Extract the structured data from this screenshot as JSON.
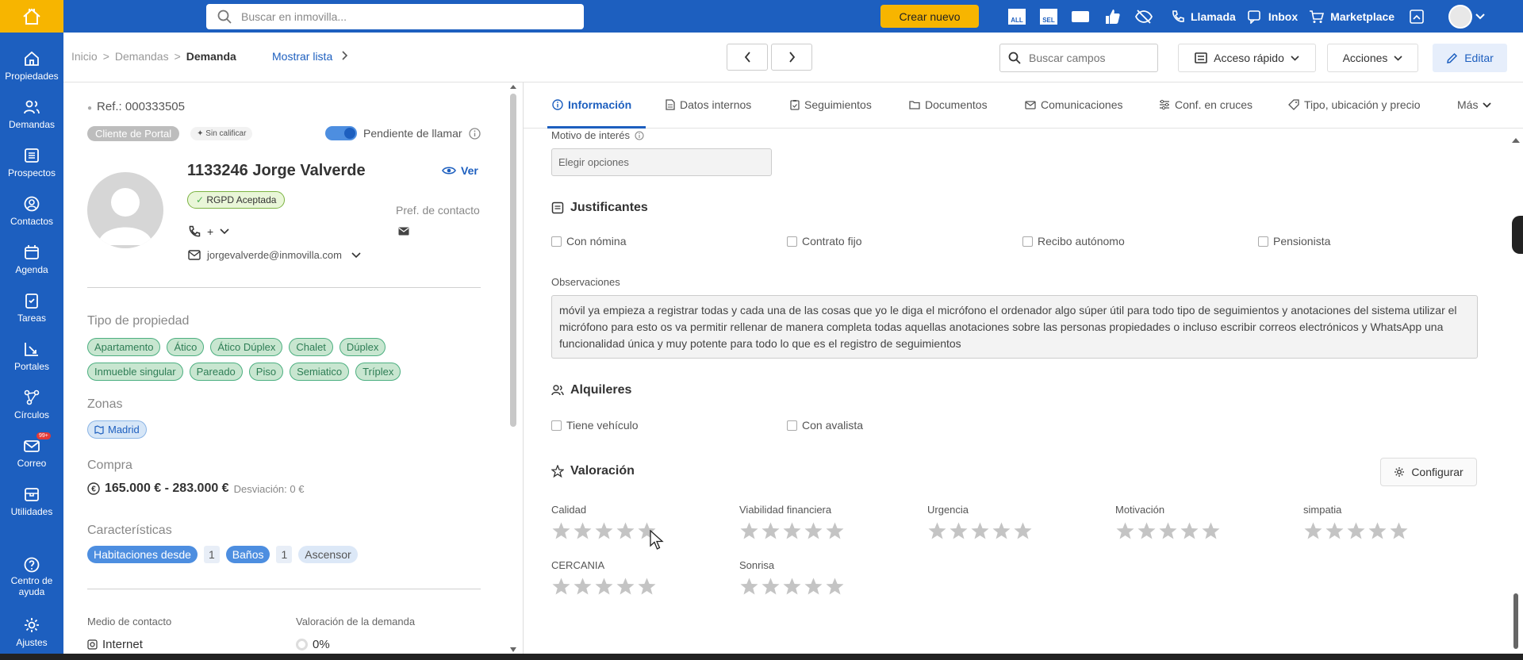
{
  "topbar": {
    "search_placeholder": "Buscar en inmovilla...",
    "create_label": "Crear nuevo",
    "links": [
      "Llamada",
      "Inbox",
      "Marketplace"
    ],
    "accent": "#1d5fbf",
    "brand_yellow": "#f7b500"
  },
  "sidebar": {
    "items": [
      {
        "label": "Propiedades",
        "icon": "home-icon"
      },
      {
        "label": "Demandas",
        "icon": "users-icon"
      },
      {
        "label": "Prospectos",
        "icon": "list-icon"
      },
      {
        "label": "Contactos",
        "icon": "contact-icon"
      },
      {
        "label": "Agenda",
        "icon": "calendar-icon"
      },
      {
        "label": "Tareas",
        "icon": "tasks-icon"
      },
      {
        "label": "Portales",
        "icon": "portals-icon"
      },
      {
        "label": "Círculos",
        "icon": "circles-icon"
      },
      {
        "label": "Correo",
        "icon": "mail-icon"
      },
      {
        "label": "Utilidades",
        "icon": "tools-icon"
      }
    ],
    "mail_badge": "99+",
    "help_label_1": "Centro de",
    "help_label_2": "ayuda",
    "settings_label": "Ajustes"
  },
  "breadcrumb": {
    "inicio": "Inicio",
    "demandas": "Demandas",
    "current": "Demanda",
    "separator": ">",
    "mostrar_lista": "Mostrar lista"
  },
  "toolbar": {
    "search_fields_placeholder": "Buscar campos",
    "quick_access": "Acceso rápido",
    "actions": "Acciones",
    "edit": "Editar"
  },
  "profile": {
    "ref": "Ref.: 000333505",
    "portal_client": "Cliente de Portal",
    "unrated": "Sin calificar",
    "pending_call": "Pendiente de llamar",
    "name": "1133246 Jorge Valverde",
    "view": "Ver",
    "rgpd": "RGPD Aceptada",
    "pref_contact": "Pref. de contacto",
    "phone_plus": "+",
    "email": "jorgevalverde@inmovilla.com"
  },
  "property_type": {
    "title": "Tipo de propiedad",
    "chips": [
      "Apartamento",
      "Ático",
      "Ático Dúplex",
      "Chalet",
      "Dúplex",
      "Inmueble singular",
      "Pareado",
      "Piso",
      "Semiatico",
      "Tríplex"
    ]
  },
  "zones": {
    "title": "Zonas",
    "chips": [
      "Madrid"
    ]
  },
  "purchase": {
    "title": "Compra",
    "range": "165.000 € - 283.000 €",
    "deviation": "Desviación: 0 €"
  },
  "features": {
    "title": "Características",
    "rooms_label": "Habitaciones desde",
    "rooms_value": "1",
    "baths_label": "Baños",
    "baths_value": "1",
    "lift": "Ascensor"
  },
  "contact_medium": {
    "label": "Medio de contacto",
    "value": "Internet"
  },
  "demand_rating": {
    "label": "Valoración de la demanda",
    "value": "0%"
  },
  "tabs": [
    "Información",
    "Datos internos",
    "Seguimientos",
    "Documentos",
    "Comunicaciones",
    "Conf. en cruces",
    "Tipo, ubicación y precio",
    "Más"
  ],
  "info": {
    "interest_label": "Motivo de interés",
    "interest_placeholder": "Elegir opciones",
    "justificantes_title": "Justificantes",
    "justificantes": [
      "Con nómina",
      "Contrato fijo",
      "Recibo autónomo",
      "Pensionista"
    ],
    "observations_label": "Observaciones",
    "observations": "móvil ya empieza a registrar todas y cada una de las cosas que yo le diga el micrófono el ordenador algo súper útil para todo tipo de seguimientos y anotaciones del sistema utilizar el micrófono para esto os va permitir rellenar de manera completa todas aquellas anotaciones sobre las personas propiedades o incluso escribir correos electrónicos y WhatsApp una funcionalidad única y muy potente para todo lo que es el registro de seguimientos",
    "rentals_title": "Alquileres",
    "rentals": [
      "Tiene vehículo",
      "Con avalista"
    ],
    "rating_title": "Valoración",
    "configure": "Configurar",
    "ratings": [
      {
        "label": "Calidad",
        "stars": 0
      },
      {
        "label": "Viabilidad financiera",
        "stars": 0
      },
      {
        "label": "Urgencia",
        "stars": 0
      },
      {
        "label": "Motivación",
        "stars": 0
      },
      {
        "label": "simpatia",
        "stars": 0
      },
      {
        "label": "CERCANIA",
        "stars": 0
      },
      {
        "label": "Sonrisa",
        "stars": 0
      }
    ]
  }
}
